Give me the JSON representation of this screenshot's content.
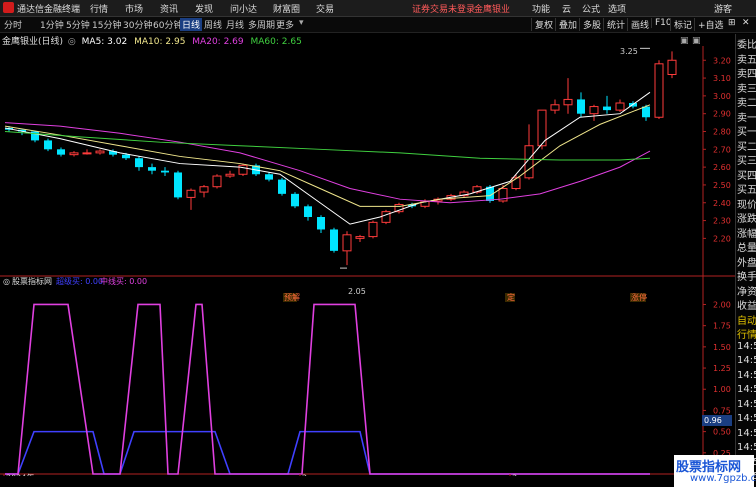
{
  "menubar": {
    "app_title": "通达信金融终端",
    "items": [
      "行情",
      "市场",
      "资讯",
      "发现",
      "问小达",
      "财富圈",
      "交易"
    ],
    "login_warning": "证券交易未登录",
    "broker": "金鹰银业",
    "right_items": [
      "功能",
      "云",
      "公式",
      "选项"
    ],
    "user": "游客"
  },
  "toolbar": {
    "periods": [
      "分时",
      "1分钟",
      "5分钟",
      "15分钟",
      "30分钟",
      "60分钟",
      "日线",
      "周线",
      "月线",
      "多周期",
      "更多"
    ],
    "active_period": "日线",
    "right_buttons": [
      "复权",
      "叠加",
      "多股",
      "统计",
      "画线",
      "F10",
      "标记",
      "+自选"
    ]
  },
  "main_chart": {
    "title": "金鹰银业(日线)",
    "ma": [
      {
        "label": "MA5: 3.02",
        "color": "#ffffff"
      },
      {
        "label": "MA10: 2.95",
        "color": "#f0e68c"
      },
      {
        "label": "MA20: 2.69",
        "color": "#e040e0"
      },
      {
        "label": "MA60: 2.65",
        "color": "#40d040"
      }
    ],
    "yaxis_labels": [
      "3.20",
      "3.10",
      "3.00",
      "2.90",
      "2.80",
      "2.70",
      "2.60",
      "2.50",
      "2.40",
      "2.30",
      "2.20"
    ],
    "high_marker": "3.25",
    "low_marker": "2.05",
    "event_tags": [
      "预解",
      "定",
      "涨停"
    ]
  },
  "sub_chart": {
    "title": "股票指标网",
    "legend": [
      {
        "label": "超级买: 0.00",
        "color": "#4040ff"
      },
      {
        "label": "中线买: 0.00",
        "color": "#e040e0"
      }
    ],
    "yaxis_labels": [
      "2.00",
      "1.75",
      "1.50",
      "1.25",
      "1.00",
      "0.75",
      "0.50",
      "0.25"
    ],
    "current_value": "0.96"
  },
  "xaxis": {
    "labels": [
      "2024年",
      "2",
      "3"
    ]
  },
  "sidepanel": {
    "labels": [
      "委比",
      "卖五",
      "卖四",
      "卖三",
      "卖二",
      "卖一",
      "买一",
      "买二",
      "买三",
      "买四",
      "买五",
      "现价",
      "涨跌",
      "涨幅",
      "总量",
      "外盘",
      "换手",
      "净资",
      "收益",
      "自动",
      "行情",
      "14:5",
      "14:5",
      "14:5",
      "14:5",
      "14:5",
      "14:5",
      "14:5",
      "14:5",
      "14:5",
      "14:5"
    ]
  },
  "watermark": {
    "line1": "股票指标网",
    "line2": "www.7gpzb.com"
  },
  "colors": {
    "up": "#ff3b3b",
    "down": "#00e5ff",
    "ma5": "#ffffff",
    "ma10": "#f0e68c",
    "ma20": "#e040e0",
    "ma60": "#40d040",
    "axis": "#b22222"
  }
}
